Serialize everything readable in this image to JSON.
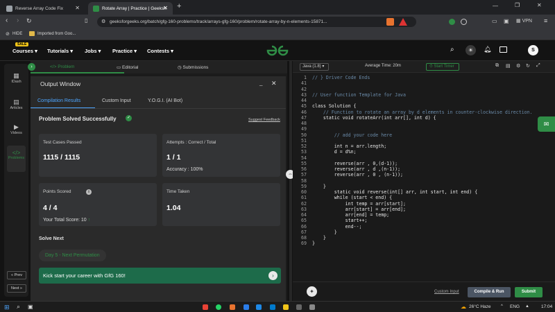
{
  "browser": {
    "tabs": [
      {
        "title": "Reverse Array Code Fix",
        "fav_color": "#9aa0a6"
      },
      {
        "title": "Rotate Array | Practice | Geeksh",
        "fav_color": "#2f8d46"
      }
    ],
    "url": "geeksforgeeks.org/batch/gfg-160-problems/track/arrays-gfg-160/problem/rotate-array-by-n-elements-15871...",
    "bookmarks": {
      "hide": "HIDE",
      "imported": "Imported from Goo..."
    },
    "vpn": "VPN"
  },
  "gfg_nav": {
    "badge": "SALE",
    "items": [
      "Courses",
      "Tutorials",
      "Jobs",
      "Practice",
      "Contests"
    ],
    "avatar": "S",
    "logo_color": "#2f8d46"
  },
  "left_rail": {
    "items": [
      "IDash",
      "Articles",
      "Videos",
      "Problems"
    ],
    "prev": "Prev",
    "next": "Next"
  },
  "problem_tabs": [
    "Problem",
    "Editorial",
    "Submissions"
  ],
  "output": {
    "title": "Output Window",
    "tabs": [
      "Compilation Results",
      "Custom Input",
      "Y.O.G.I. (AI Bot)"
    ],
    "status": "Problem Solved Successfully",
    "feedback": "Suggest Feedback",
    "cards": {
      "tests_label": "Test Cases Passed",
      "tests_value": "1115 / 1115",
      "attempts_label": "Attempts : Correct / Total",
      "attempts_value": "1 / 1",
      "accuracy_text": "Accuracy : 100%",
      "points_label": "Points Scored",
      "points_value": "4 / 4",
      "total_score_text": "Your Total Score: 10",
      "time_label": "Time Taken",
      "time_value": "1.04"
    },
    "solve_next_label": "Solve Next",
    "next_chip": "Day 5 - Next Permutation",
    "banner": "Kick start your career with GfG 160!"
  },
  "editor": {
    "language": "Java (1.8)",
    "avg_time": "Average Time: 20m",
    "timer": "Start Timer",
    "lines": [
      {
        "n": "1",
        "t": "// } Driver Code Ends"
      },
      {
        "n": "41",
        "t": ""
      },
      {
        "n": "42",
        "t": ""
      },
      {
        "n": "43",
        "t": "// User function Template for Java"
      },
      {
        "n": "44",
        "t": ""
      },
      {
        "n": "45",
        "t": "class Solution {"
      },
      {
        "n": "46",
        "t": "    // Function to rotate an array by d elements in counter-clockwise direction."
      },
      {
        "n": "47",
        "t": "    static void rotateArr(int arr[], int d) {"
      },
      {
        "n": "48",
        "t": ""
      },
      {
        "n": "49",
        "t": ""
      },
      {
        "n": "50",
        "t": "        // add your code here"
      },
      {
        "n": "51",
        "t": ""
      },
      {
        "n": "52",
        "t": "        int n = arr.length;"
      },
      {
        "n": "53",
        "t": "        d = d%n;"
      },
      {
        "n": "54",
        "t": ""
      },
      {
        "n": "55",
        "t": "        reverse(arr , 0,(d-1));"
      },
      {
        "n": "56",
        "t": "        reverse(arr , d ,(n-1));"
      },
      {
        "n": "57",
        "t": "        reverse(arr , 0 , (n-1));"
      },
      {
        "n": "58",
        "t": ""
      },
      {
        "n": "59",
        "t": "    }"
      },
      {
        "n": "60",
        "t": "        static void reverse(int[] arr, int start, int end) {"
      },
      {
        "n": "61",
        "t": "        while (start < end) {"
      },
      {
        "n": "62",
        "t": "            int temp = arr[start];"
      },
      {
        "n": "63",
        "t": "            arr[start] = arr[end];"
      },
      {
        "n": "64",
        "t": "            arr[end] = temp;"
      },
      {
        "n": "65",
        "t": "            start++;"
      },
      {
        "n": "66",
        "t": "            end--;"
      },
      {
        "n": "67",
        "t": "        }"
      },
      {
        "n": "68",
        "t": "    }"
      },
      {
        "n": "69",
        "t": "}"
      }
    ],
    "custom_input": "Custom Input",
    "compile_run": "Compile & Run",
    "submit": "Submit"
  },
  "taskbar": {
    "weather": "26°C  Haze",
    "lang": "ENG",
    "time": "17:04"
  }
}
